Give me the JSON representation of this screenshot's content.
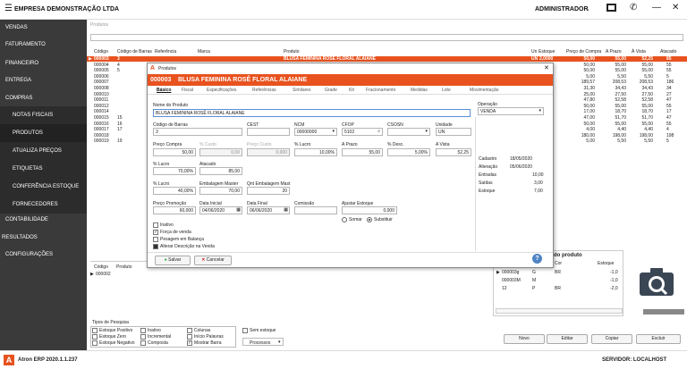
{
  "app": {
    "company": "EMPRESA DEMONSTRAÇÃO LTDA",
    "user": "ADMINISTRADOR",
    "version": "Atron ERP 2020.1.1.237",
    "server": "SERVIDOR: LOCALHOST"
  },
  "sidebar": {
    "items": [
      "VENDAS",
      "FATURAMENTO",
      "FINANCEIRO",
      "ENTREGA",
      "COMPRAS",
      "NOTAS FISCAIS",
      "PRODUTOS",
      "ATUALIZA PREÇOS",
      "ETIQUETAS",
      "CONFERÊNCIA ESTOQUE",
      "FORNECEDORES",
      "CONTABILIDADE",
      "RESULTADOS",
      "CONFIGURAÇÕES"
    ]
  },
  "grid": {
    "breadcrumb": "Produtos",
    "headers": [
      "Código",
      "Código de Barras",
      "Referência",
      "Marca",
      "Produto",
      "Un",
      "Estoque",
      "Preço de Compra",
      "A Prazo",
      "À Vista",
      "Atacado"
    ],
    "rows": [
      [
        "000003",
        "3",
        "",
        "",
        "BLUSA FEMININA ROSÊ FLORAL ALAIANE",
        "UN",
        "2,0000",
        "50,00",
        "55,00",
        "52,25",
        "85"
      ],
      [
        "000004",
        "4",
        "",
        "",
        "",
        "",
        "0000",
        "50,00",
        "55,00",
        "55,00",
        "55"
      ],
      [
        "000005",
        "5",
        "",
        "",
        "",
        "",
        "0000",
        "50,00",
        "55,00",
        "55,00",
        "55"
      ],
      [
        "000006",
        "",
        "",
        "",
        "",
        "",
        "0000",
        "5,00",
        "5,50",
        "5,50",
        "5"
      ],
      [
        "000007",
        "",
        "",
        "",
        "",
        "",
        "0000",
        "189,57",
        "208,53",
        "208,53",
        "186"
      ],
      [
        "000008",
        "",
        "",
        "",
        "",
        "",
        "0000",
        "31,30",
        "34,43",
        "34,43",
        "34"
      ],
      [
        "000010",
        "",
        "",
        "",
        "",
        "",
        "0000",
        "25,00",
        "27,50",
        "27,50",
        "27"
      ],
      [
        "000011",
        "",
        "",
        "",
        "",
        "",
        "0000",
        "47,80",
        "52,58",
        "52,58",
        "47"
      ],
      [
        "000012",
        "",
        "",
        "",
        "",
        "",
        "0000",
        "50,00",
        "55,00",
        "55,00",
        "55"
      ],
      [
        "000014",
        "",
        "",
        "",
        "",
        "",
        "0000",
        "17,00",
        "18,70",
        "18,70",
        "17"
      ],
      [
        "000015",
        "15",
        "",
        "",
        "",
        "",
        "0000",
        "47,00",
        "51,70",
        "51,70",
        "47"
      ],
      [
        "000016",
        "16",
        "",
        "",
        "",
        "",
        "0000",
        "50,00",
        "55,00",
        "55,00",
        "55"
      ],
      [
        "000017",
        "17",
        "",
        "",
        "",
        "",
        "0000",
        "4,00",
        "4,40",
        "4,40",
        "4"
      ],
      [
        "000018",
        "",
        "",
        "",
        "",
        "",
        "0000",
        "180,00",
        "198,00",
        "198,00",
        "198"
      ],
      [
        "000019",
        "19",
        "",
        "",
        "",
        "",
        "0000",
        "5,00",
        "5,50",
        "5,50",
        "5"
      ]
    ]
  },
  "lower": {
    "headers": [
      "Código",
      "Produto"
    ],
    "row": "000002",
    "panel_title": "do produto",
    "panel_cols": [
      "Cor",
      "Estoque"
    ],
    "panel_rows": [
      [
        "000003g",
        "G",
        "BR",
        "-1,0"
      ],
      [
        "000003M",
        "M",
        "",
        "-1,0"
      ],
      [
        "12",
        "P",
        "BR",
        "-2,0"
      ]
    ]
  },
  "filters": {
    "title": "Tipos de Pesquisa",
    "options": [
      [
        "Estoque Positivo",
        "Estoque Zero",
        "Estoque Negativo"
      ],
      [
        "Inativo",
        "Incremental",
        "Composta"
      ],
      [
        "Colunas",
        "Início Palavras",
        "Mostrar Barra"
      ]
    ],
    "checked": [
      "Mostrar Barra"
    ],
    "no_stock": "Sem estoque",
    "processes": "Processos"
  },
  "actions": {
    "new": "Novo",
    "edit": "Editar",
    "copy": "Copiar",
    "delete": "Excluir"
  },
  "dialog": {
    "window_title": "Produtos",
    "code": "000003",
    "name": "BLUSA FEMININA ROSÊ FLORAL ALAIANE",
    "tabs": [
      "Básico",
      "Fiscal",
      "Especificações",
      "Referências",
      "Similares",
      "Grade",
      "Kit",
      "Fracionamento",
      "Medidas",
      "Lote",
      "Movimentação"
    ],
    "fields": {
      "nome_label": "Nome do Produto",
      "nome": "BLUSA FEMININA ROSÊ FLORAL ALAIANE",
      "operacao_label": "Operação",
      "operacao": "VENDA",
      "barras_label": "Código de Barras",
      "barras": "3",
      "cest_label": "CEST",
      "ncm_label": "NCM",
      "ncm": "00000000",
      "cfop_label": "CFOP",
      "cfop": "5102",
      "csosn_label": "CSOSN",
      "unidade_label": "Unidade",
      "unidade": "UN",
      "pcompra_label": "Preço Compra",
      "pcompra": "50,00",
      "pcusto_pct_label": "% Custo",
      "pcusto_pct": "0,00",
      "pcusto_label": "Preço Custo",
      "pcusto": "0,000",
      "plucro_label": "% Lucro",
      "plucro": "10,00%",
      "aprazo_label": "A Prazo",
      "aprazo": "55,00",
      "pdesc_label": "% Desc.",
      "pdesc": "5,00%",
      "avista_label": "A Vista",
      "avista": "52,25",
      "lucro2_label": "% Lucro",
      "lucro2": "70,00%",
      "atacado_label": "Atacado",
      "atacado": "85,00",
      "lucro3_label": "% Lucro",
      "lucro3": "40,00%",
      "embmaster_label": "Embalagem Master",
      "embmaster": "70,00",
      "qntemb_label": "Qnt Embalagem Mast",
      "qntemb": "20",
      "promo_label": "Preço Promoção",
      "promo": "60,000",
      "dtini_label": "Data Inicial",
      "dtini": "04/06/2020",
      "dtfim_label": "Data Final",
      "dtfim": "06/06/2020",
      "comissao_label": "Comissão",
      "ajuste_label": "Ajustar Estoque",
      "ajuste": "0,000",
      "somar": "Somar",
      "substituir": "Substituir"
    },
    "info": {
      "cadastro_label": "Cadastro",
      "cadastro": "18/05/2020",
      "alteracao_label": "Alteração",
      "alteracao": "05/06/2020",
      "entradas_label": "Entradas",
      "entradas": "10,00",
      "saidas_label": "Saídas",
      "saidas": "3,00",
      "estoque_label": "Estoque",
      "estoque": "7,00"
    },
    "checks": [
      "Inativo",
      "Força de venda",
      "Pesagem em Balança",
      "Alterar Descrição na Venda"
    ],
    "save": "Salvar",
    "cancel": "Cancelar"
  },
  "colors": {
    "accent": "#e8521e",
    "sidebar": "#3a3a3a"
  }
}
